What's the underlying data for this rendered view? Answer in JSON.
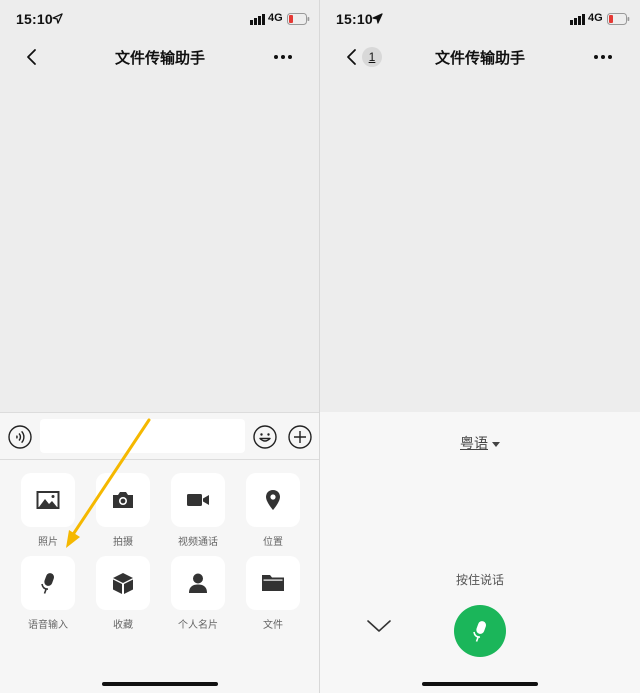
{
  "status_bar": {
    "time": "15:10",
    "network": "4G"
  },
  "left_screen": {
    "nav": {
      "title": "文件传输助手"
    },
    "tools": [
      {
        "label": "照片",
        "icon": "photo-icon"
      },
      {
        "label": "拍摄",
        "icon": "camera-icon"
      },
      {
        "label": "视频通话",
        "icon": "video-call-icon"
      },
      {
        "label": "位置",
        "icon": "location-icon"
      },
      {
        "label": "语音输入",
        "icon": "mic-icon"
      },
      {
        "label": "收藏",
        "icon": "favorites-icon"
      },
      {
        "label": "个人名片",
        "icon": "contact-card-icon"
      },
      {
        "label": "文件",
        "icon": "folder-icon"
      }
    ]
  },
  "right_screen": {
    "nav": {
      "title": "文件传输助手",
      "badge": "1"
    },
    "voice": {
      "language": "粤语",
      "hold_to_talk": "按住说话"
    }
  },
  "colors": {
    "accent_green": "#1bb65a",
    "arrow": "#f5b800"
  }
}
